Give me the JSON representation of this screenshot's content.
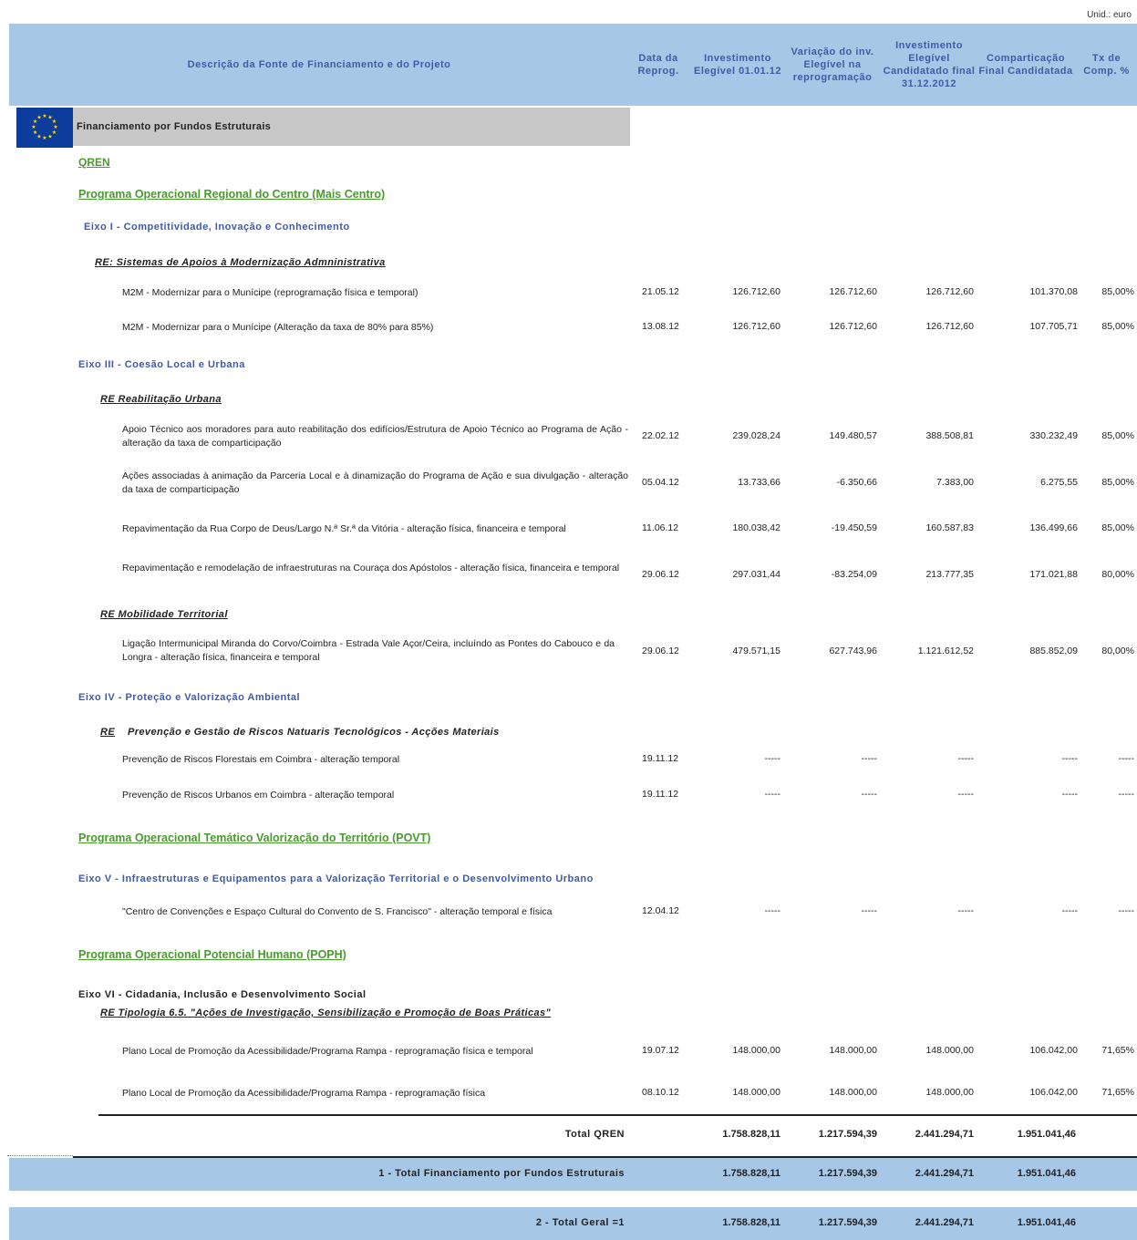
{
  "unit_label": "Unid.: euro",
  "header": {
    "col_desc": "Descrição da Fonte de Financiamento e do Projeto",
    "col_date": "Data da Reprog.",
    "col_inv": "Investimento Elegível 01.01.12",
    "col_var": "Variação do inv. Elegível na reprogramação",
    "col_cand": "Investimento Elegível Candidatado final 31.12.2012",
    "col_comp": "Comparticação Final Candidatada",
    "col_tx": "Tx de Comp. %"
  },
  "funding_label": "Financiamento por Fundos Estruturais",
  "qren_label": "QREN",
  "programs": {
    "p1": "Programa Operacional Regional do Centro (Mais Centro)",
    "p2": "Programa Operacional Temático Valorização do Território (POVT)",
    "p3": "Programa Operacional Potencial Humano (POPH)"
  },
  "axes": {
    "e1": "Eixo I - Competitividade, Inovação e Conhecimento",
    "e3": "Eixo III - Coesão Local e Urbana",
    "e4": "Eixo IV - Proteção e Valorização Ambiental",
    "e5": "Eixo V - Infraestruturas e Equipamentos para a Valorização Territorial e o Desenvolvimento Urbano",
    "e6": "Eixo VI - Cidadania, Inclusão e Desenvolvimento Social"
  },
  "regs": {
    "r1": "RE: Sistemas de Apoios à Modernização Admninistrativa",
    "r2": "RE Reabilitação Urbana",
    "r3": "RE Mobilidade Territorial",
    "r4a": "RE",
    "r4b": "Prevenção e Gestão de Riscos Natuaris Tecnológicos - Acções Materiais",
    "r5": "RE Tipologia 6.5. \"Ações de Investigação, Sensibilização e Promoção de Boas Práticas\""
  },
  "rows": [
    {
      "desc": "M2M - Modernizar para o Munícipe (reprogramação física e temporal)",
      "date": "21.05.12",
      "inv": "126.712,60",
      "var": "126.712,60",
      "cand": "126.712,60",
      "comp": "101.370,08",
      "tx": "85,00%"
    },
    {
      "desc": "M2M - Modernizar para o Munícipe (Alteração da taxa de 80% para 85%)",
      "date": "13.08.12",
      "inv": "126.712,60",
      "var": "126.712,60",
      "cand": "126.712,60",
      "comp": "107.705,71",
      "tx": "85,00%"
    },
    {
      "desc": "Apoio Técnico aos moradores para auto reabilitação dos edifícios/Estrutura de Apoio Técnico ao Programa de Ação - alteração da taxa de comparticipação",
      "date": "22.02.12",
      "inv": "239.028,24",
      "var": "149.480,57",
      "cand": "388.508,81",
      "comp": "330.232,49",
      "tx": "85,00%"
    },
    {
      "desc": "Ações associadas à animação da Parceria Local e à dinamização do Programa de Ação e sua divulgação - alteração da taxa de comparticipação",
      "date": "05.04.12",
      "inv": "13.733,66",
      "var": "-6.350,66",
      "cand": "7.383,00",
      "comp": "6.275,55",
      "tx": "85,00%"
    },
    {
      "desc": "Repavimentação da Rua Corpo de Deus/Largo N.ª Sr.ª da Vitória - alteração física, financeira e temporal",
      "date": "11.06.12",
      "inv": "180.038,42",
      "var": "-19.450,59",
      "cand": "160.587,83",
      "comp": "136.499,66",
      "tx": "85,00%"
    },
    {
      "desc": "Repavimentação e remodelação de infraestruturas na Couraça dos Apóstolos - alteração física, financeira e temporal",
      "date": "29.06.12",
      "inv": "297.031,44",
      "var": "-83.254,09",
      "cand": "213.777,35",
      "comp": "171.021,88",
      "tx": "80,00%"
    },
    {
      "desc": "Ligação Intermunicipal Miranda do Corvo/Coimbra - Estrada Vale Açor/Ceira, incluíndo as Pontes do Cabouco e da Longra - alteração física, financeira e temporal",
      "date": "29.06.12",
      "inv": "479.571,15",
      "var": "627.743,96",
      "cand": "1.121.612,52",
      "comp": "885.852,09",
      "tx": "80,00%"
    },
    {
      "desc": "Prevenção de Riscos Florestais em Coimbra - alteração temporal",
      "date": "19.11.12",
      "inv": "-----",
      "var": "-----",
      "cand": "-----",
      "comp": "-----",
      "tx": "-----"
    },
    {
      "desc": "Prevenção de Riscos Urbanos em Coimbra - alteração temporal",
      "date": "19.11.12",
      "inv": "-----",
      "var": "-----",
      "cand": "-----",
      "comp": "-----",
      "tx": "-----"
    },
    {
      "desc": "\"Centro de Convenções e Espaço Cultural do Convento de S. Francisco\" - alteração temporal e física",
      "date": "12.04.12",
      "inv": "-----",
      "var": "-----",
      "cand": "-----",
      "comp": "-----",
      "tx": "-----"
    },
    {
      "desc": "Plano Local de Promoção da Acessibilidade/Programa Rampa - reprogramação física e temporal",
      "date": "19.07.12",
      "inv": "148.000,00",
      "var": "148.000,00",
      "cand": "148.000,00",
      "comp": "106.042,00",
      "tx": "71,65%"
    },
    {
      "desc": "Plano Local de Promoção da Acessibilidade/Programa Rampa - reprogramação física",
      "date": "08.10.12",
      "inv": "148.000,00",
      "var": "148.000,00",
      "cand": "148.000,00",
      "comp": "106.042,00",
      "tx": "71,65%"
    }
  ],
  "totals": [
    {
      "label": "Total QREN",
      "inv": "1.758.828,11",
      "var": "1.217.594,39",
      "cand": "2.441.294,71",
      "comp": "1.951.041,46"
    },
    {
      "label": "1 - Total Financiamento por Fundos Estruturais",
      "inv": "1.758.828,11",
      "var": "1.217.594,39",
      "cand": "2.441.294,71",
      "comp": "1.951.041,46"
    },
    {
      "label": "2 - Total Geral =1",
      "inv": "1.758.828,11",
      "var": "1.217.594,39",
      "cand": "2.441.294,71",
      "comp": "1.951.041,46"
    }
  ],
  "colors": {
    "header_band": "#a7c7e7",
    "header_text": "#3f5ba8",
    "program_green": "#4a9a2e",
    "fund_band": "#c7c7c7",
    "eu_flag_blue": "#0c3c9c",
    "eu_stars": "#ffdd00"
  },
  "icons": {
    "eu_flag": "eu-flag-icon"
  }
}
